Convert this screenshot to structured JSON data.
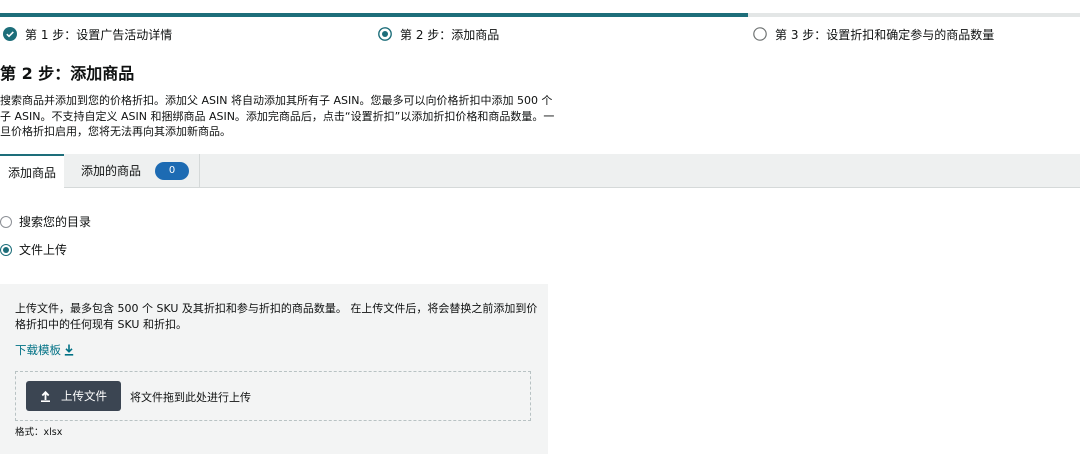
{
  "steps": [
    {
      "label": "第 1 步：设置广告活动详情",
      "state": "complete"
    },
    {
      "label": "第 2 步：添加商品",
      "state": "current"
    },
    {
      "label": "第 3 步：设置折扣和确定参与的商品数量",
      "state": "pending"
    }
  ],
  "progress": {
    "completed_fraction": 0.693
  },
  "page": {
    "title": "第 2 步：添加商品",
    "description": "搜索商品并添加到您的价格折扣。添加父 ASIN 将自动添加其所有子 ASIN。您最多可以向价格折扣中添加 500 个子 ASIN。不支持自定义 ASIN 和捆绑商品 ASIN。添加完商品后，点击“设置折扣”以添加折扣价格和商品数量。一旦价格折扣启用，您将无法再向其添加新商品。"
  },
  "tabs": {
    "add_label": "添加商品",
    "added_label": "添加的商品",
    "added_count": "0"
  },
  "options": {
    "search_catalog": "搜索您的目录",
    "file_upload": "文件上传",
    "selected": "file_upload"
  },
  "upload": {
    "instructions": "上传文件，最多包含 500 个 SKU 及其折扣和参与折扣的商品数量。 在上传文件后，将会替换之前添加到价格折扣中的任何现有 SKU 和折扣。",
    "download_template": "下载模板",
    "button_label": "上传文件",
    "drop_hint": "将文件拖到此处进行上传",
    "format_label": "格式：xlsx"
  },
  "colors": {
    "accent": "#1d6e7a",
    "pill": "#1d6bb3",
    "button": "#3b4552",
    "link": "#007185"
  }
}
